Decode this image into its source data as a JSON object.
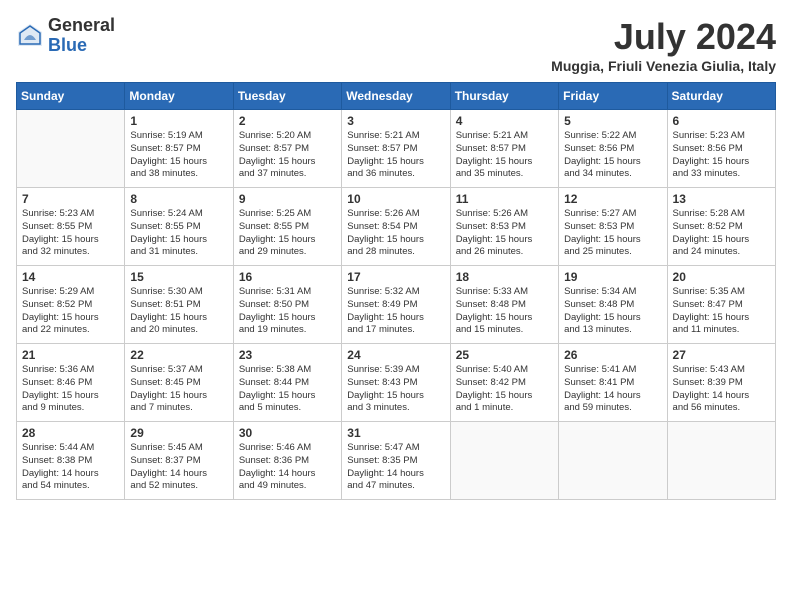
{
  "header": {
    "logo_general": "General",
    "logo_blue": "Blue",
    "month_title": "July 2024",
    "location": "Muggia, Friuli Venezia Giulia, Italy"
  },
  "weekdays": [
    "Sunday",
    "Monday",
    "Tuesday",
    "Wednesday",
    "Thursday",
    "Friday",
    "Saturday"
  ],
  "weeks": [
    [
      {
        "day": "",
        "info": ""
      },
      {
        "day": "1",
        "info": "Sunrise: 5:19 AM\nSunset: 8:57 PM\nDaylight: 15 hours\nand 38 minutes."
      },
      {
        "day": "2",
        "info": "Sunrise: 5:20 AM\nSunset: 8:57 PM\nDaylight: 15 hours\nand 37 minutes."
      },
      {
        "day": "3",
        "info": "Sunrise: 5:21 AM\nSunset: 8:57 PM\nDaylight: 15 hours\nand 36 minutes."
      },
      {
        "day": "4",
        "info": "Sunrise: 5:21 AM\nSunset: 8:57 PM\nDaylight: 15 hours\nand 35 minutes."
      },
      {
        "day": "5",
        "info": "Sunrise: 5:22 AM\nSunset: 8:56 PM\nDaylight: 15 hours\nand 34 minutes."
      },
      {
        "day": "6",
        "info": "Sunrise: 5:23 AM\nSunset: 8:56 PM\nDaylight: 15 hours\nand 33 minutes."
      }
    ],
    [
      {
        "day": "7",
        "info": "Sunrise: 5:23 AM\nSunset: 8:55 PM\nDaylight: 15 hours\nand 32 minutes."
      },
      {
        "day": "8",
        "info": "Sunrise: 5:24 AM\nSunset: 8:55 PM\nDaylight: 15 hours\nand 31 minutes."
      },
      {
        "day": "9",
        "info": "Sunrise: 5:25 AM\nSunset: 8:55 PM\nDaylight: 15 hours\nand 29 minutes."
      },
      {
        "day": "10",
        "info": "Sunrise: 5:26 AM\nSunset: 8:54 PM\nDaylight: 15 hours\nand 28 minutes."
      },
      {
        "day": "11",
        "info": "Sunrise: 5:26 AM\nSunset: 8:53 PM\nDaylight: 15 hours\nand 26 minutes."
      },
      {
        "day": "12",
        "info": "Sunrise: 5:27 AM\nSunset: 8:53 PM\nDaylight: 15 hours\nand 25 minutes."
      },
      {
        "day": "13",
        "info": "Sunrise: 5:28 AM\nSunset: 8:52 PM\nDaylight: 15 hours\nand 24 minutes."
      }
    ],
    [
      {
        "day": "14",
        "info": "Sunrise: 5:29 AM\nSunset: 8:52 PM\nDaylight: 15 hours\nand 22 minutes."
      },
      {
        "day": "15",
        "info": "Sunrise: 5:30 AM\nSunset: 8:51 PM\nDaylight: 15 hours\nand 20 minutes."
      },
      {
        "day": "16",
        "info": "Sunrise: 5:31 AM\nSunset: 8:50 PM\nDaylight: 15 hours\nand 19 minutes."
      },
      {
        "day": "17",
        "info": "Sunrise: 5:32 AM\nSunset: 8:49 PM\nDaylight: 15 hours\nand 17 minutes."
      },
      {
        "day": "18",
        "info": "Sunrise: 5:33 AM\nSunset: 8:48 PM\nDaylight: 15 hours\nand 15 minutes."
      },
      {
        "day": "19",
        "info": "Sunrise: 5:34 AM\nSunset: 8:48 PM\nDaylight: 15 hours\nand 13 minutes."
      },
      {
        "day": "20",
        "info": "Sunrise: 5:35 AM\nSunset: 8:47 PM\nDaylight: 15 hours\nand 11 minutes."
      }
    ],
    [
      {
        "day": "21",
        "info": "Sunrise: 5:36 AM\nSunset: 8:46 PM\nDaylight: 15 hours\nand 9 minutes."
      },
      {
        "day": "22",
        "info": "Sunrise: 5:37 AM\nSunset: 8:45 PM\nDaylight: 15 hours\nand 7 minutes."
      },
      {
        "day": "23",
        "info": "Sunrise: 5:38 AM\nSunset: 8:44 PM\nDaylight: 15 hours\nand 5 minutes."
      },
      {
        "day": "24",
        "info": "Sunrise: 5:39 AM\nSunset: 8:43 PM\nDaylight: 15 hours\nand 3 minutes."
      },
      {
        "day": "25",
        "info": "Sunrise: 5:40 AM\nSunset: 8:42 PM\nDaylight: 15 hours\nand 1 minute."
      },
      {
        "day": "26",
        "info": "Sunrise: 5:41 AM\nSunset: 8:41 PM\nDaylight: 14 hours\nand 59 minutes."
      },
      {
        "day": "27",
        "info": "Sunrise: 5:43 AM\nSunset: 8:39 PM\nDaylight: 14 hours\nand 56 minutes."
      }
    ],
    [
      {
        "day": "28",
        "info": "Sunrise: 5:44 AM\nSunset: 8:38 PM\nDaylight: 14 hours\nand 54 minutes."
      },
      {
        "day": "29",
        "info": "Sunrise: 5:45 AM\nSunset: 8:37 PM\nDaylight: 14 hours\nand 52 minutes."
      },
      {
        "day": "30",
        "info": "Sunrise: 5:46 AM\nSunset: 8:36 PM\nDaylight: 14 hours\nand 49 minutes."
      },
      {
        "day": "31",
        "info": "Sunrise: 5:47 AM\nSunset: 8:35 PM\nDaylight: 14 hours\nand 47 minutes."
      },
      {
        "day": "",
        "info": ""
      },
      {
        "day": "",
        "info": ""
      },
      {
        "day": "",
        "info": ""
      }
    ]
  ]
}
